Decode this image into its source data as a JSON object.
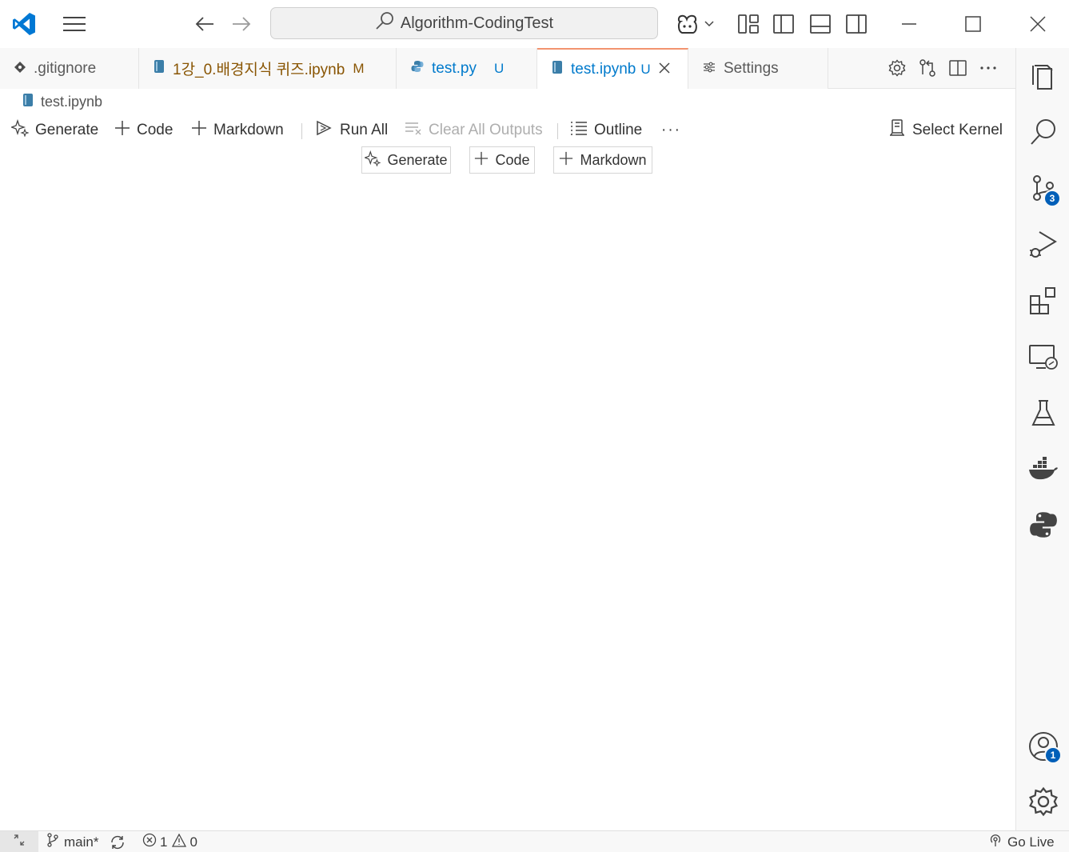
{
  "titlebar": {
    "search_text": "Algorithm-CodingTest",
    "icons": [
      "vscode-logo-icon",
      "menu-icon",
      "back-arrow-icon",
      "forward-arrow-icon",
      "copilot-icon",
      "customize-layout-icon",
      "toggle-primary-sidebar-icon",
      "toggle-panel-icon",
      "toggle-secondary-sidebar-icon",
      "minimize-icon",
      "maximize-icon",
      "close-icon"
    ]
  },
  "tabs": [
    {
      "label": ".gitignore",
      "status": "",
      "color": "#5a5a5a"
    },
    {
      "label": "1강_0.배경지식 퀴즈.ipynb",
      "status": "M",
      "color": "#895503"
    },
    {
      "label": "test.py",
      "status": "U",
      "color": "#007acc"
    },
    {
      "label": "test.ipynb",
      "status": "U",
      "color": "#007acc"
    },
    {
      "label": "Settings",
      "status": "",
      "color": "#5a5a5a"
    }
  ],
  "breadcrumb": {
    "file": "test.ipynb"
  },
  "notebook_toolbar": {
    "generate": "Generate",
    "code": "Code",
    "markdown": "Markdown",
    "run_all": "Run All",
    "clear_outputs": "Clear All Outputs",
    "outline": "Outline",
    "more": "···",
    "select_kernel": "Select Kernel"
  },
  "insert_toolbar": {
    "generate": "Generate",
    "code": "Code",
    "markdown": "Markdown"
  },
  "activitybar": {
    "source_control_badge": "3",
    "accounts_badge": "1"
  },
  "statusbar": {
    "branch": "main*",
    "errors": "1",
    "warnings": "0",
    "go_live": "Go Live"
  },
  "colors": {
    "accent": "#005fb8",
    "active_tab_border": "#f2936f",
    "modified": "#895503",
    "untracked": "#007acc"
  }
}
